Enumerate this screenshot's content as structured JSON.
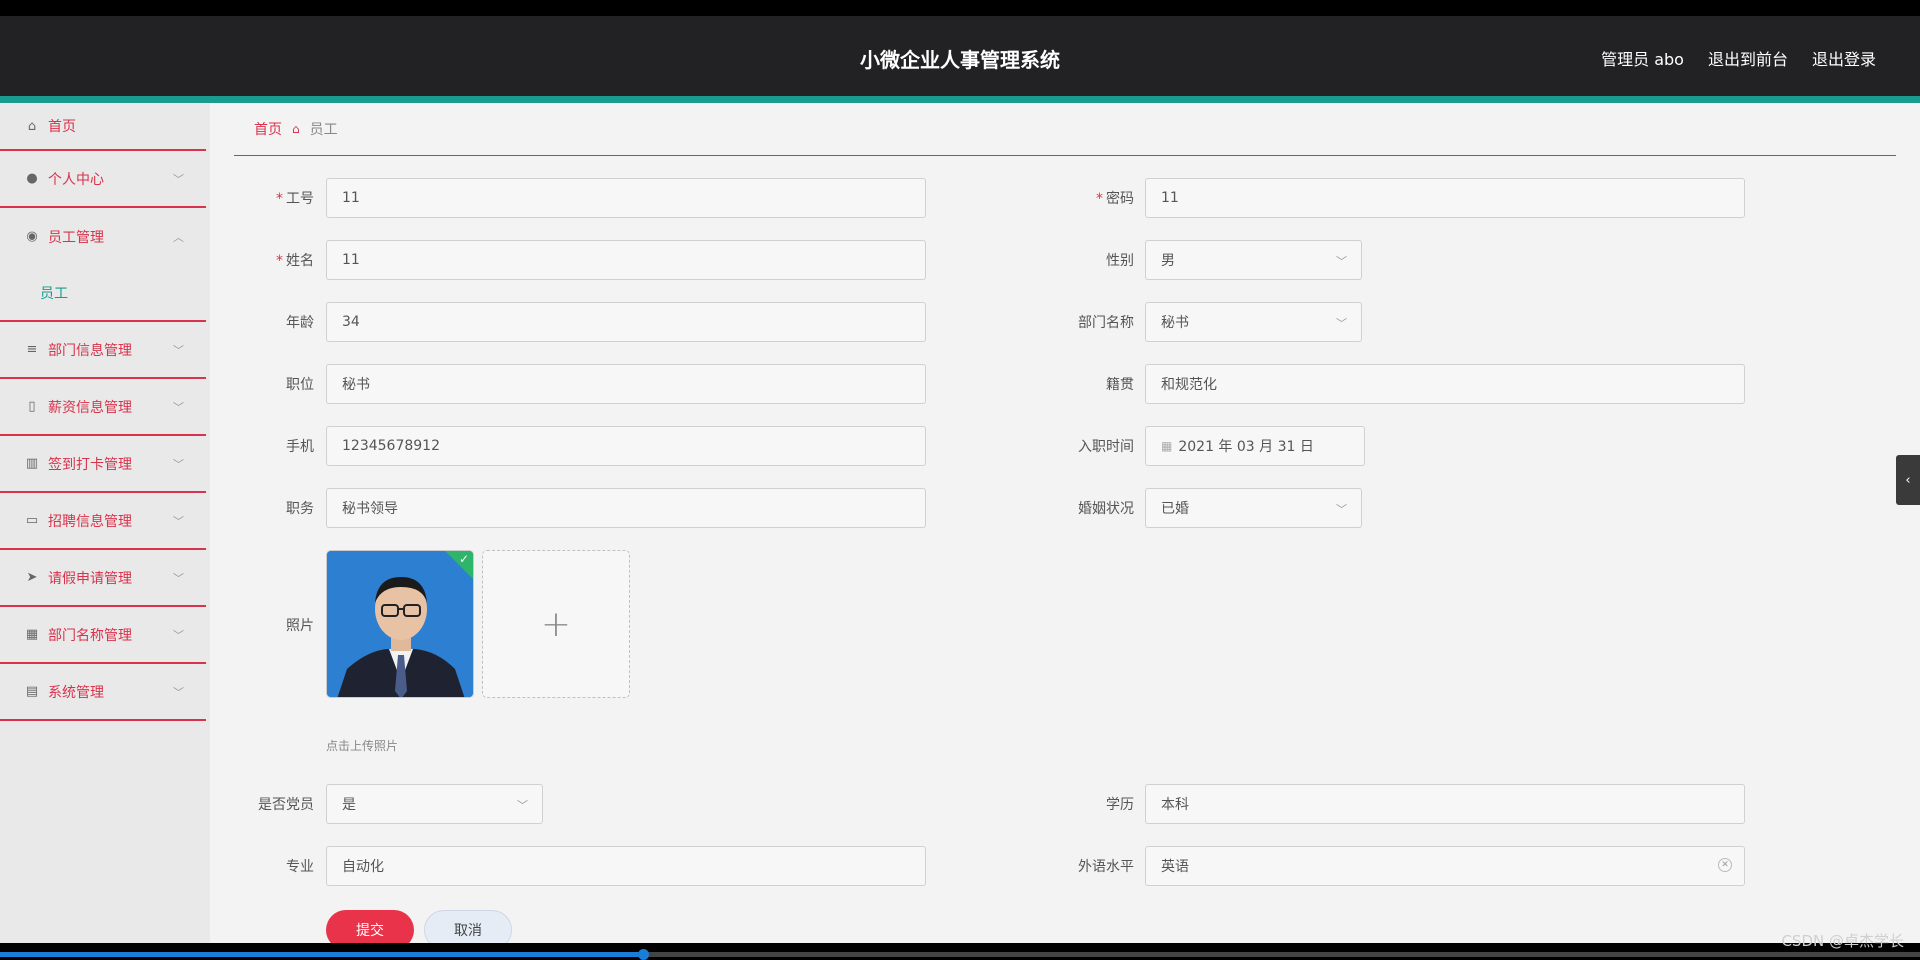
{
  "header": {
    "title": "小微企业人事管理系统",
    "user": "管理员 abo",
    "to_front": "退出到前台",
    "logout": "退出登录"
  },
  "sidebar": {
    "items": [
      {
        "label": "首页",
        "icon": "home-icon"
      },
      {
        "label": "个人中心",
        "icon": "user-icon",
        "chevron": "down"
      },
      {
        "label": "员工管理",
        "icon": "pin-icon",
        "chevron": "up"
      },
      {
        "label": "员工",
        "sub": true
      },
      {
        "label": "部门信息管理",
        "icon": "list-icon",
        "chevron": "down"
      },
      {
        "label": "薪资信息管理",
        "icon": "mic-icon",
        "chevron": "down"
      },
      {
        "label": "签到打卡管理",
        "icon": "books-icon",
        "chevron": "down"
      },
      {
        "label": "招聘信息管理",
        "icon": "card-icon",
        "chevron": "down"
      },
      {
        "label": "请假申请管理",
        "icon": "plane-icon",
        "chevron": "down"
      },
      {
        "label": "部门名称管理",
        "icon": "grid-icon",
        "chevron": "down"
      },
      {
        "label": "系统管理",
        "icon": "clipboard-icon",
        "chevron": "down"
      }
    ]
  },
  "breadcrumb": {
    "home": "首页",
    "current": "员工"
  },
  "form": {
    "gonghao": {
      "label": "工号",
      "value": "11",
      "required": true
    },
    "mima": {
      "label": "密码",
      "value": "11",
      "required": true
    },
    "xingming": {
      "label": "姓名",
      "value": "11",
      "required": true
    },
    "xingbie": {
      "label": "性别",
      "value": "男"
    },
    "nianling": {
      "label": "年龄",
      "value": "34"
    },
    "bumen": {
      "label": "部门名称",
      "value": "秘书"
    },
    "zhiwei": {
      "label": "职位",
      "value": "秘书"
    },
    "jiguan": {
      "label": "籍贯",
      "value": "和规范化"
    },
    "shouji": {
      "label": "手机",
      "value": "12345678912"
    },
    "ruzhi": {
      "label": "入职时间",
      "value": "2021 年 03 月 31 日"
    },
    "zhiwu": {
      "label": "职务",
      "value": "秘书领导"
    },
    "hunyin": {
      "label": "婚姻状况",
      "value": "已婚"
    },
    "zhaopian": {
      "label": "照片",
      "hint": "点击上传照片"
    },
    "dangyuan": {
      "label": "是否党员",
      "value": "是"
    },
    "xueli": {
      "label": "学历",
      "value": "本科"
    },
    "zhuanye": {
      "label": "专业",
      "value": "自动化"
    },
    "waiyu": {
      "label": "外语水平",
      "value": "英语"
    }
  },
  "buttons": {
    "submit": "提交",
    "cancel": "取消"
  },
  "video": {
    "progress": 0.335
  },
  "watermark": "CSDN @卓杰学长",
  "colors": {
    "accent": "#d8324c",
    "header": "#222123",
    "teal": "#1a9b8f",
    "submit": "#e8334a"
  }
}
